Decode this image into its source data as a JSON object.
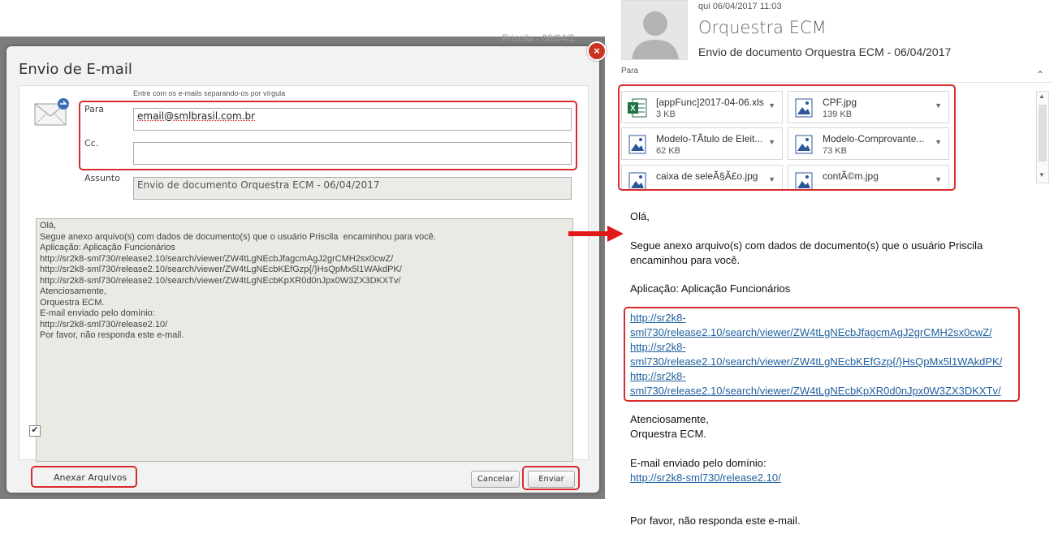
{
  "dialog": {
    "backdrop_text": "Priscila - 06/04/2",
    "title": "Envio de E-mail",
    "close_label": "×",
    "hint": "Entre com os e-mails separando-os por vírgula",
    "para_label": "Para",
    "para_value": "email@smlbrasil.com.br",
    "cc_label": "Cc.",
    "cc_value": "",
    "assunto_label": "Assunto",
    "assunto_value": "Envio de documento Orquestra ECM - 06/04/2017",
    "body_lines": [
      "Olá,",
      "",
      "Segue anexo arquivo(s) com dados de documento(s) que o usuário Priscila  encaminhou para você.",
      "",
      "Aplicação: Aplicação Funcionários",
      "",
      "http://sr2k8-sml730/release2.10/search/viewer/ZW4tLgNEcbJfagcmAgJ2grCMH2sx0cwZ/",
      "http://sr2k8-sml730/release2.10/search/viewer/ZW4tLgNEcbKEfGzp{/}HsQpMx5l1WAkdPK/",
      "http://sr2k8-sml730/release2.10/search/viewer/ZW4tLgNEcbKpXR0d0nJpx0W3ZX3DKXTv/",
      "",
      "Atenciosamente,",
      "Orquestra ECM.",
      "",
      "E-mail enviado pelo domínio:",
      "http://sr2k8-sml730/release2.10/",
      "",
      "",
      "Por favor, não responda este e-mail."
    ],
    "anexar_label": "Anexar Arquivos",
    "anexar_checked": "✔",
    "cancel_label": "Cancelar",
    "send_label": "Enviar"
  },
  "email": {
    "date": "qui 06/04/2017 11:03",
    "from": "Orquestra ECM",
    "subject": "Envio de documento Orquestra ECM - 06/04/2017",
    "para_label": "Para",
    "attachments": [
      {
        "name": "[appFunc]2017-04-06.xls",
        "size": "3 KB",
        "icon": "excel-icon"
      },
      {
        "name": "CPF.jpg",
        "size": "139 KB",
        "icon": "image-icon"
      },
      {
        "name": "Modelo-TÃtulo de Eleit...",
        "size": "62 KB",
        "icon": "image-icon"
      },
      {
        "name": "Modelo-Comprovante...",
        "size": "73 KB",
        "icon": "image-icon"
      },
      {
        "name": "caixa de seleÃ§Ã£o.jpg",
        "size": "",
        "icon": "image-icon"
      },
      {
        "name": "contÃ©m.jpg",
        "size": "",
        "icon": "image-icon"
      }
    ],
    "greeting": "Olá,",
    "paragraph1_line1": "Segue anexo arquivo(s) com dados de documento(s) que o usuário Priscila",
    "paragraph1_line2": "encaminhou para você.",
    "aplicacao": "Aplicação: Aplicação Funcionários",
    "links": [
      [
        "http://sr2k8-",
        "sml730/release2.10/search/viewer/ZW4tLgNEcbJfagcmAgJ2grCMH2sx0cwZ/"
      ],
      [
        "http://sr2k8-",
        "sml730/release2.10/search/viewer/ZW4tLgNEcbKEfGzp{/}HsQpMx5l1WAkdPK/"
      ],
      [
        "http://sr2k8-",
        "sml730/release2.10/search/viewer/ZW4tLgNEcbKpXR0d0nJpx0W3ZX3DKXTv/"
      ]
    ],
    "sign1": "Atenciosamente,",
    "sign2": "Orquestra ECM.",
    "domain_label": "E-mail enviado pelo domínio:",
    "domain_link": "http://sr2k8-sml730/release2.10/",
    "footer": "Por favor, não responda este e-mail."
  },
  "colors": {
    "highlight": "#d82c2c",
    "link": "#1f5f9e",
    "arrow": "#e01818"
  }
}
